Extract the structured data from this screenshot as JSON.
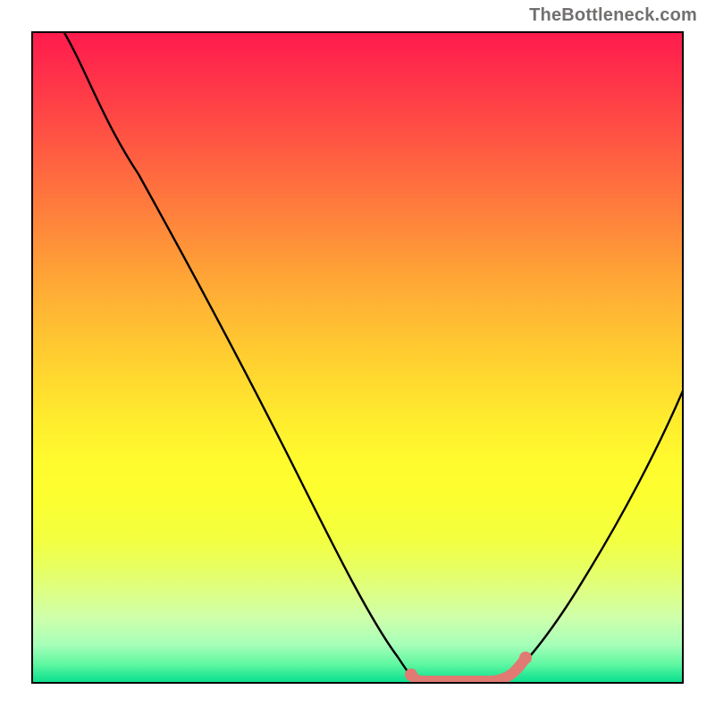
{
  "watermark": {
    "text": "TheBottleneck.com"
  },
  "chart_data": {
    "type": "line",
    "title": "",
    "xlabel": "",
    "ylabel": "",
    "xlim": [
      0,
      100
    ],
    "ylim": [
      0,
      100
    ],
    "grid": false,
    "legend": false,
    "series": [
      {
        "name": "curve",
        "x": [
          5,
          10,
          15,
          20,
          25,
          30,
          35,
          40,
          45,
          50,
          55,
          58,
          60,
          62,
          64,
          67,
          70,
          73,
          78,
          83,
          88,
          93,
          97,
          100
        ],
        "y": [
          100,
          92,
          83,
          74,
          65,
          56,
          46,
          37,
          27,
          17,
          8,
          3,
          1,
          0,
          0,
          0,
          0,
          2,
          7,
          15,
          24,
          35,
          45,
          54
        ]
      },
      {
        "name": "highlight-band",
        "x": [
          58,
          60,
          62,
          64,
          67,
          70,
          73
        ],
        "y": [
          3,
          1,
          0,
          0,
          0,
          0,
          2
        ]
      }
    ],
    "colors": {
      "curve": "#000000",
      "highlight": "#e07a72",
      "gradient_top": "#ff1a4d",
      "gradient_bottom": "#07df8e"
    }
  }
}
